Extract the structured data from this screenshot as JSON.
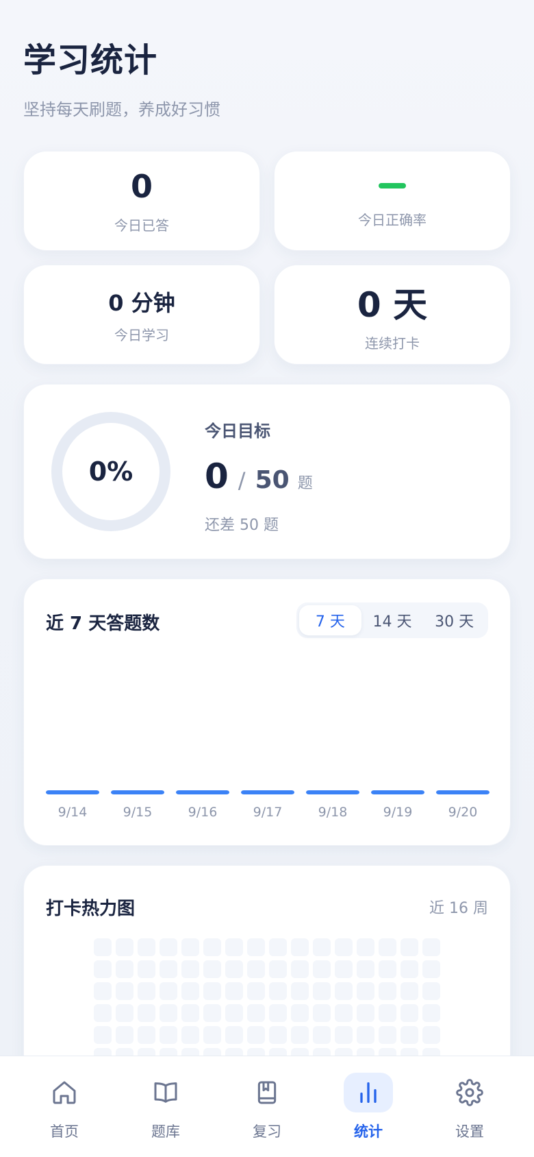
{
  "header": {
    "title": "学习统计",
    "subtitle": "坚持每天刷题，养成好习惯"
  },
  "stats": {
    "answered_today": {
      "value": "0",
      "label": "今日已答"
    },
    "accuracy_today": {
      "value": "",
      "label": "今日正确率",
      "color": "#22c55e"
    },
    "study_today": {
      "value": "0 分钟",
      "label": "今日学习"
    },
    "streak": {
      "value": "0 天",
      "label": "连续打卡"
    }
  },
  "goal": {
    "progress_text": "0%",
    "progress": 0,
    "title": "今日目标",
    "current": "0",
    "separator": "/",
    "total": "50",
    "unit": "题",
    "remaining": "还差 50 题"
  },
  "daily_chart": {
    "title": "近 7 天答题数",
    "ranges": [
      "7 天",
      "14 天",
      "30 天"
    ],
    "active_range": 0
  },
  "chart_data": {
    "type": "bar",
    "categories": [
      "9/14",
      "9/15",
      "9/16",
      "9/17",
      "9/18",
      "9/19",
      "9/20"
    ],
    "values": [
      0,
      0,
      0,
      0,
      0,
      0,
      0
    ],
    "title": "近 7 天答题数",
    "color": "#3b82f6"
  },
  "heatmap": {
    "title": "打卡热力图",
    "range_label": "近 16 周",
    "weeks": 16,
    "days": 7,
    "empty_color": "#f3f6fb"
  },
  "tabbar": {
    "items": [
      {
        "label": "首页",
        "icon": "home-icon"
      },
      {
        "label": "题库",
        "icon": "book-icon"
      },
      {
        "label": "复习",
        "icon": "bookmark-book-icon"
      },
      {
        "label": "统计",
        "icon": "bar-chart-icon"
      },
      {
        "label": "设置",
        "icon": "gear-icon"
      }
    ],
    "active": 3,
    "accent": "#2563eb"
  }
}
